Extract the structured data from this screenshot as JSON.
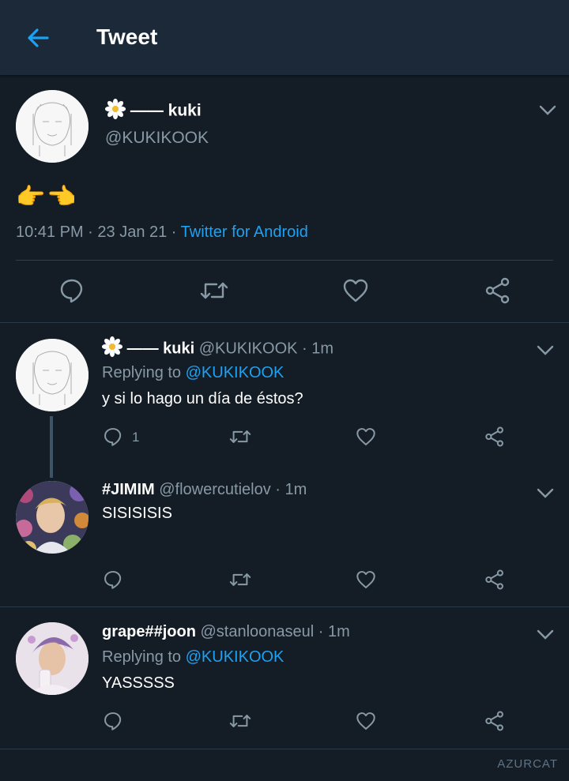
{
  "header": {
    "title": "Tweet"
  },
  "main_tweet": {
    "display_name": "—— kuki",
    "handle": "@KUKIKOOK",
    "text": "👉👈",
    "time": "10:41 PM",
    "sep1": " · ",
    "date": "23 Jan 21",
    "sep2": " · ",
    "source": "Twitter for Android"
  },
  "replies": [
    {
      "display_name": "—— kuki",
      "handle": "@KUKIKOOK",
      "time": " · 1m",
      "replying_prefix": "Replying to ",
      "replying_to": "@KUKIKOOK",
      "text": "y si lo hago un día de éstos?",
      "reply_count": "1"
    },
    {
      "display_name": "#JIMIM",
      "handle": "@flowercutielov",
      "time": " · 1m",
      "text": "SISISISIS"
    },
    {
      "display_name": "grape##joon",
      "handle": "@stanloonaseul",
      "time": " · 1m",
      "replying_prefix": "Replying to ",
      "replying_to": "@KUKIKOOK",
      "text": "YASSSSS"
    }
  ],
  "watermark": "AZURCAT",
  "colors": {
    "background": "#141d26",
    "header": "#1c2938",
    "accent": "#1da1f2",
    "muted": "#8899a6"
  }
}
